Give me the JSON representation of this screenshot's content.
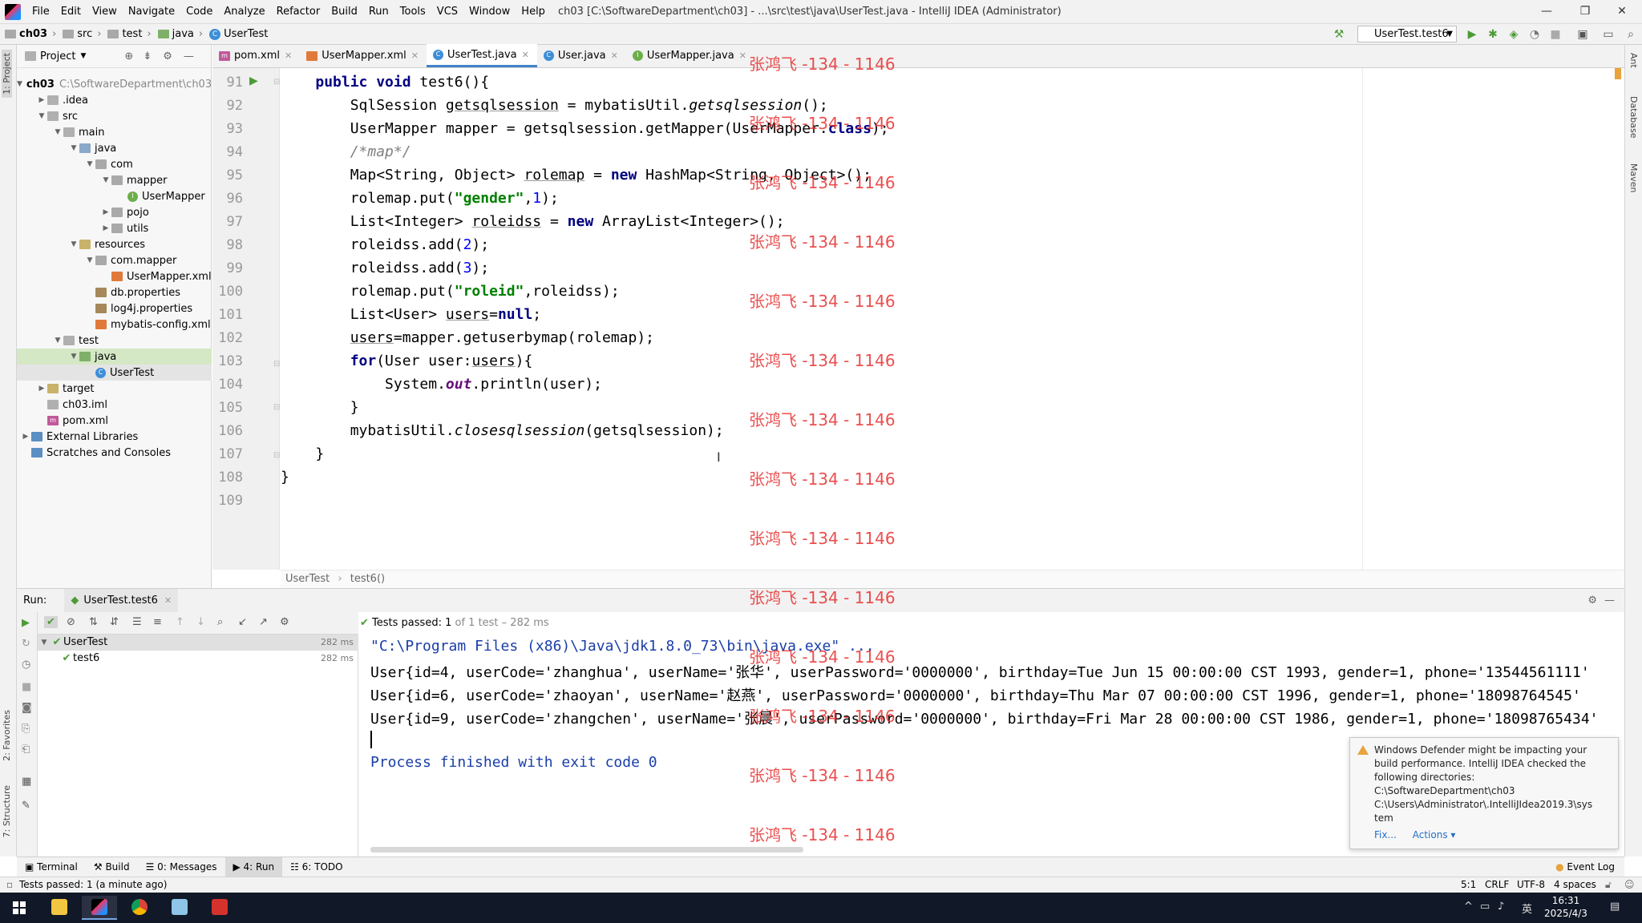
{
  "window": {
    "title": "ch03 [C:\\SoftwareDepartment\\ch03] - ...\\src\\test\\java\\UserTest.java - IntelliJ IDEA (Administrator)",
    "menu": [
      "File",
      "Edit",
      "View",
      "Navigate",
      "Code",
      "Analyze",
      "Refactor",
      "Build",
      "Run",
      "Tools",
      "VCS",
      "Window",
      "Help"
    ]
  },
  "breadcrumb": [
    "ch03",
    "src",
    "test",
    "java",
    "UserTest"
  ],
  "run_config": "UserTest.test6",
  "project": {
    "header": "Project",
    "tree": [
      {
        "label": "ch03",
        "extra": "C:\\SoftwareDepartment\\ch03",
        "depth": 0,
        "icon": "folder",
        "arrow": "down"
      },
      {
        "label": ".idea",
        "depth": 1,
        "icon": "folder",
        "arrow": "right"
      },
      {
        "label": "src",
        "depth": 1,
        "icon": "folder",
        "arrow": "down"
      },
      {
        "label": "main",
        "depth": 2,
        "icon": "folder",
        "arrow": "down"
      },
      {
        "label": "java",
        "depth": 3,
        "icon": "src",
        "arrow": "down"
      },
      {
        "label": "com",
        "depth": 4,
        "icon": "pkg",
        "arrow": "down"
      },
      {
        "label": "mapper",
        "depth": 5,
        "icon": "pkg",
        "arrow": "down"
      },
      {
        "label": "UserMapper",
        "depth": 6,
        "icon": "intf",
        "arrow": ""
      },
      {
        "label": "pojo",
        "depth": 5,
        "icon": "pkg",
        "arrow": "right"
      },
      {
        "label": "utils",
        "depth": 5,
        "icon": "pkg",
        "arrow": "right"
      },
      {
        "label": "resources",
        "depth": 3,
        "icon": "res",
        "arrow": "down"
      },
      {
        "label": "com.mapper",
        "depth": 4,
        "icon": "pkg",
        "arrow": "down"
      },
      {
        "label": "UserMapper.xml",
        "depth": 5,
        "icon": "xml",
        "arrow": ""
      },
      {
        "label": "db.properties",
        "depth": 4,
        "icon": "prop",
        "arrow": ""
      },
      {
        "label": "log4j.properties",
        "depth": 4,
        "icon": "prop",
        "arrow": ""
      },
      {
        "label": "mybatis-config.xml",
        "depth": 4,
        "icon": "xml",
        "arrow": ""
      },
      {
        "label": "test",
        "depth": 2,
        "icon": "folder",
        "arrow": "down"
      },
      {
        "label": "java",
        "depth": 3,
        "icon": "test",
        "arrow": "down",
        "state": "selected"
      },
      {
        "label": "UserTest",
        "depth": 4,
        "icon": "cls",
        "arrow": "",
        "state": "selected2"
      },
      {
        "label": "target",
        "depth": 1,
        "icon": "res",
        "arrow": "right"
      },
      {
        "label": "ch03.iml",
        "depth": 1,
        "icon": "folder",
        "arrow": ""
      },
      {
        "label": "pom.xml",
        "depth": 1,
        "icon": "mvn",
        "arrow": ""
      },
      {
        "label": "External Libraries",
        "depth": 0,
        "icon": "lib",
        "arrow": "right"
      },
      {
        "label": "Scratches and Consoles",
        "depth": 0,
        "icon": "lib",
        "arrow": ""
      }
    ]
  },
  "editor_tabs": [
    {
      "label": "pom.xml",
      "icon": "mvn"
    },
    {
      "label": "UserMapper.xml",
      "icon": "xml"
    },
    {
      "label": "UserTest.java",
      "icon": "cls",
      "active": true
    },
    {
      "label": "User.java",
      "icon": "cls"
    },
    {
      "label": "UserMapper.java",
      "icon": "intf"
    }
  ],
  "code": {
    "line_numbers": [
      "91",
      "92",
      "93",
      "94",
      "95",
      "96",
      "97",
      "98",
      "99",
      "100",
      "101",
      "102",
      "103",
      "104",
      "105",
      "106",
      "107",
      "108",
      "109"
    ]
  },
  "editor_breadcrumb": [
    "UserTest",
    "test6()"
  ],
  "watermark": "张鸿飞 -134 - 1146",
  "run": {
    "label": "Run:",
    "tab": "UserTest.test6",
    "status_main": "Tests passed: 1",
    "status_sub": "of 1 test – 282 ms",
    "tests": [
      {
        "name": "UserTest",
        "time": "282 ms"
      },
      {
        "name": "test6",
        "time": "282 ms"
      }
    ],
    "console": [
      "\"C:\\Program Files (x86)\\Java\\jdk1.8.0_73\\bin\\java.exe\" ...",
      "User{id=4, userCode='zhanghua', userName='张华', userPassword='0000000', birthday=Tue Jun 15 00:00:00 CST 1993, gender=1, phone='13544561111'",
      "User{id=6, userCode='zhaoyan', userName='赵燕', userPassword='0000000', birthday=Thu Mar 07 00:00:00 CST 1996, gender=1, phone='18098764545'",
      "User{id=9, userCode='zhangchen', userName='张晨', userPassword='0000000', birthday=Fri Mar 28 00:00:00 CST 1986, gender=1, phone='18098765434'",
      "Process finished with exit code 0"
    ]
  },
  "notification": {
    "text": "Windows Defender might be impacting your build performance. IntelliJ IDEA checked the following directories:",
    "dirs": [
      "C:\\SoftwareDepartment\\ch03",
      "C:\\Users\\Administrator\\.IntelliJIdea2019.3\\sys",
      "tem"
    ],
    "fix": "Fix...",
    "actions": "Actions ▾"
  },
  "tool_tabs": [
    {
      "label": "Terminal"
    },
    {
      "label": "Build"
    },
    {
      "label": "0: Messages"
    },
    {
      "label": "4: Run",
      "active": true
    },
    {
      "label": "6: TODO"
    }
  ],
  "event_log": "Event Log",
  "status": {
    "message": "Tests passed: 1 (a minute ago)",
    "position": "5:1",
    "line_sep": "CRLF",
    "encoding": "UTF-8",
    "indent": "4 spaces"
  },
  "side_labels": {
    "project": "1: Project",
    "favorites": "2: Favorites",
    "structure": "7: Structure",
    "ant": "Ant",
    "database": "Database",
    "maven": "Maven"
  },
  "taskbar": {
    "time": "16:31",
    "date": "2025/4/3",
    "ime": "英"
  }
}
